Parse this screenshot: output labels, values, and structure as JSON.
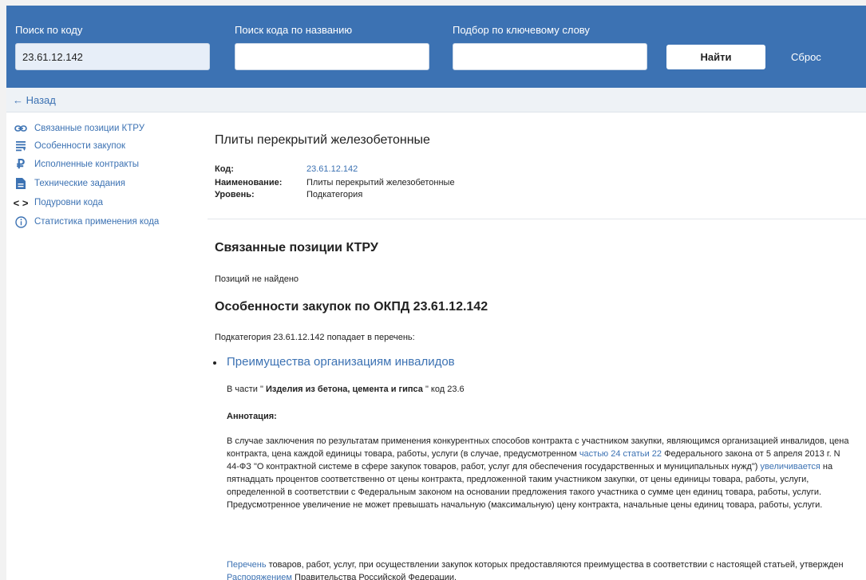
{
  "search": {
    "code_label": "Поиск по коду",
    "code_value": "23.61.12.142",
    "name_label": "Поиск кода по названию",
    "name_value": "",
    "keyword_label": "Подбор по ключевому слову",
    "keyword_value": "",
    "find_button": "Найти",
    "reset_link": "Сброс"
  },
  "back_link": "← Назад",
  "sidebar": {
    "items": [
      {
        "label": "Связанные позиции КТРУ",
        "icon": "link-icon"
      },
      {
        "label": "Особенности закупок",
        "icon": "list-icon"
      },
      {
        "label": "Исполненные контракты",
        "icon": "ruble-icon"
      },
      {
        "label": "Технические задания",
        "icon": "document-icon"
      },
      {
        "label": "Подуровни кода",
        "icon": "code-brackets-icon"
      },
      {
        "label": "Статистика применения кода",
        "icon": "info-icon"
      }
    ]
  },
  "product": {
    "title": "Плиты перекрытий железобетонные",
    "code_key": "Код:",
    "code_value": "23.61.12.142",
    "name_key": "Наименование:",
    "name_value": "Плиты перекрытий железобетонные",
    "level_key": "Уровень:",
    "level_value": "Подкатегория"
  },
  "ktru": {
    "heading": "Связанные позиции КТРУ",
    "empty_text": "Позиций не найдено"
  },
  "features": {
    "heading": "Особенности закупок по ОКПД 23.61.12.142",
    "intro": "Подкатегория 23.61.12.142 попадает в перечень:",
    "advantage_title": "Преимущества организациям инвалидов",
    "part_prefix": "В части \"",
    "part_bold": " Изделия из бетона, цемента и гипса ",
    "part_suffix": "\" код 23.6",
    "annotation_label": "Аннотация:",
    "p1_a": "В случае заключения по результатам применения конкурентных способов контракта с участником закупки, являющимся организацией инвалидов, цена контракта, цена каждой единицы товара, работы, услуги (в случае, предусмотренном ",
    "p1_link1": "частью 24 статьи 22",
    "p1_b": " Федерального закона от 5 апреля 2013 г. N 44-ФЗ \"О контрактной системе в сфере закупок товаров, работ, услуг для обеспечения государственных и муниципальных нужд\") ",
    "p1_link2": "увеличивается",
    "p1_c": " на пятнадцать процентов соответственно от цены контракта, предложенной таким участником закупки, от цены единицы товара, работы, услуги, определенной в соответствии с Федеральным законом на основании предложения такого участника о сумме цен единиц товара, работы, услуги. Предусмотренное увеличение не может превышать начальную (максимальную) цену контракта, начальные цены единиц товара, работы, услуги.",
    "p2_link1": "Перечень",
    "p2_a": " товаров, работ, услуг, при осуществлении закупок которых предоставляются преимущества в соответствии с настоящей статьей, утвержден ",
    "p2_link2": "Распоряжением",
    "p2_b": " Правительства Российской Федерации."
  },
  "colors": {
    "header_bg": "#3c72b3",
    "link": "#3c72b3",
    "back_bar_bg": "#eef2f6"
  }
}
